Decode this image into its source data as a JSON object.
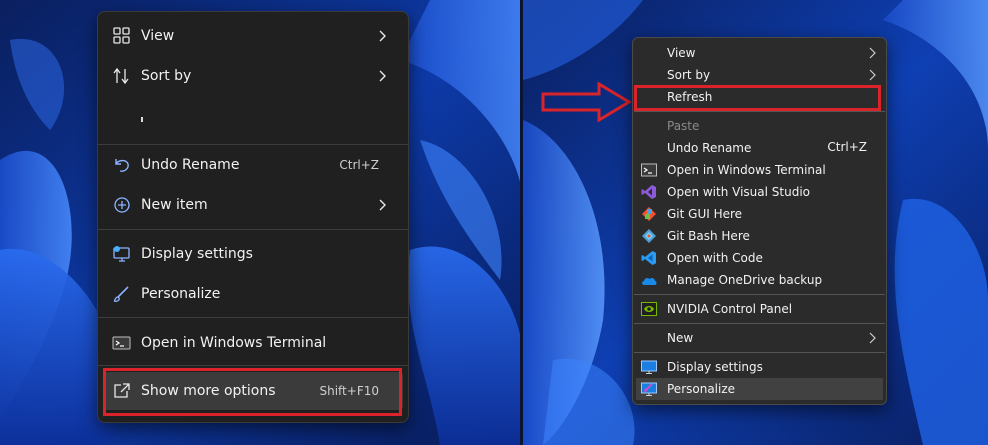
{
  "left_menu": {
    "items": [
      {
        "label": "View",
        "icon": "view-grid-icon",
        "has_submenu": true
      },
      {
        "label": "Sort by",
        "icon": "sort-icon",
        "has_submenu": true
      },
      {
        "label": "Undo Rename",
        "icon": "undo-icon",
        "shortcut": "Ctrl+Z"
      },
      {
        "label": "New item",
        "icon": "plus-circle-icon",
        "has_submenu": true
      },
      {
        "label": "Display settings",
        "icon": "display-icon"
      },
      {
        "label": "Personalize",
        "icon": "brush-icon"
      },
      {
        "label": "Open in Windows Terminal",
        "icon": "terminal-icon"
      },
      {
        "label": "Show more options",
        "icon": "share-icon",
        "shortcut": "Shift+F10",
        "highlighted": true
      }
    ]
  },
  "right_menu": {
    "items": [
      {
        "label": "View",
        "has_submenu": true
      },
      {
        "label": "Sort by",
        "has_submenu": true
      },
      {
        "label": "Refresh",
        "highlighted": true
      },
      {
        "label": "Paste",
        "disabled": true
      },
      {
        "label": "Undo Rename",
        "shortcut": "Ctrl+Z"
      },
      {
        "label": "Open in Windows Terminal",
        "icon": "terminal-icon"
      },
      {
        "label": "Open with Visual Studio",
        "icon": "visual-studio-icon"
      },
      {
        "label": "Git GUI Here",
        "icon": "git-gui-icon"
      },
      {
        "label": "Git Bash Here",
        "icon": "git-bash-icon"
      },
      {
        "label": "Open with Code",
        "icon": "vscode-icon"
      },
      {
        "label": "Manage OneDrive backup",
        "icon": "onedrive-icon"
      },
      {
        "label": "NVIDIA Control Panel",
        "icon": "nvidia-icon"
      },
      {
        "label": "New",
        "has_submenu": true
      },
      {
        "label": "Display settings",
        "icon": "display-icon"
      },
      {
        "label": "Personalize",
        "icon": "personalize-icon",
        "hovered": true
      }
    ]
  },
  "annotation": {
    "arrow": "red-outline-arrow",
    "color": "#d8242a"
  },
  "colors": {
    "menu_bg_left": "#202020",
    "menu_bg_right": "#2b2b2b",
    "highlight_box": "#d8242a",
    "wallpaper_blue": "#1e5bd8"
  }
}
